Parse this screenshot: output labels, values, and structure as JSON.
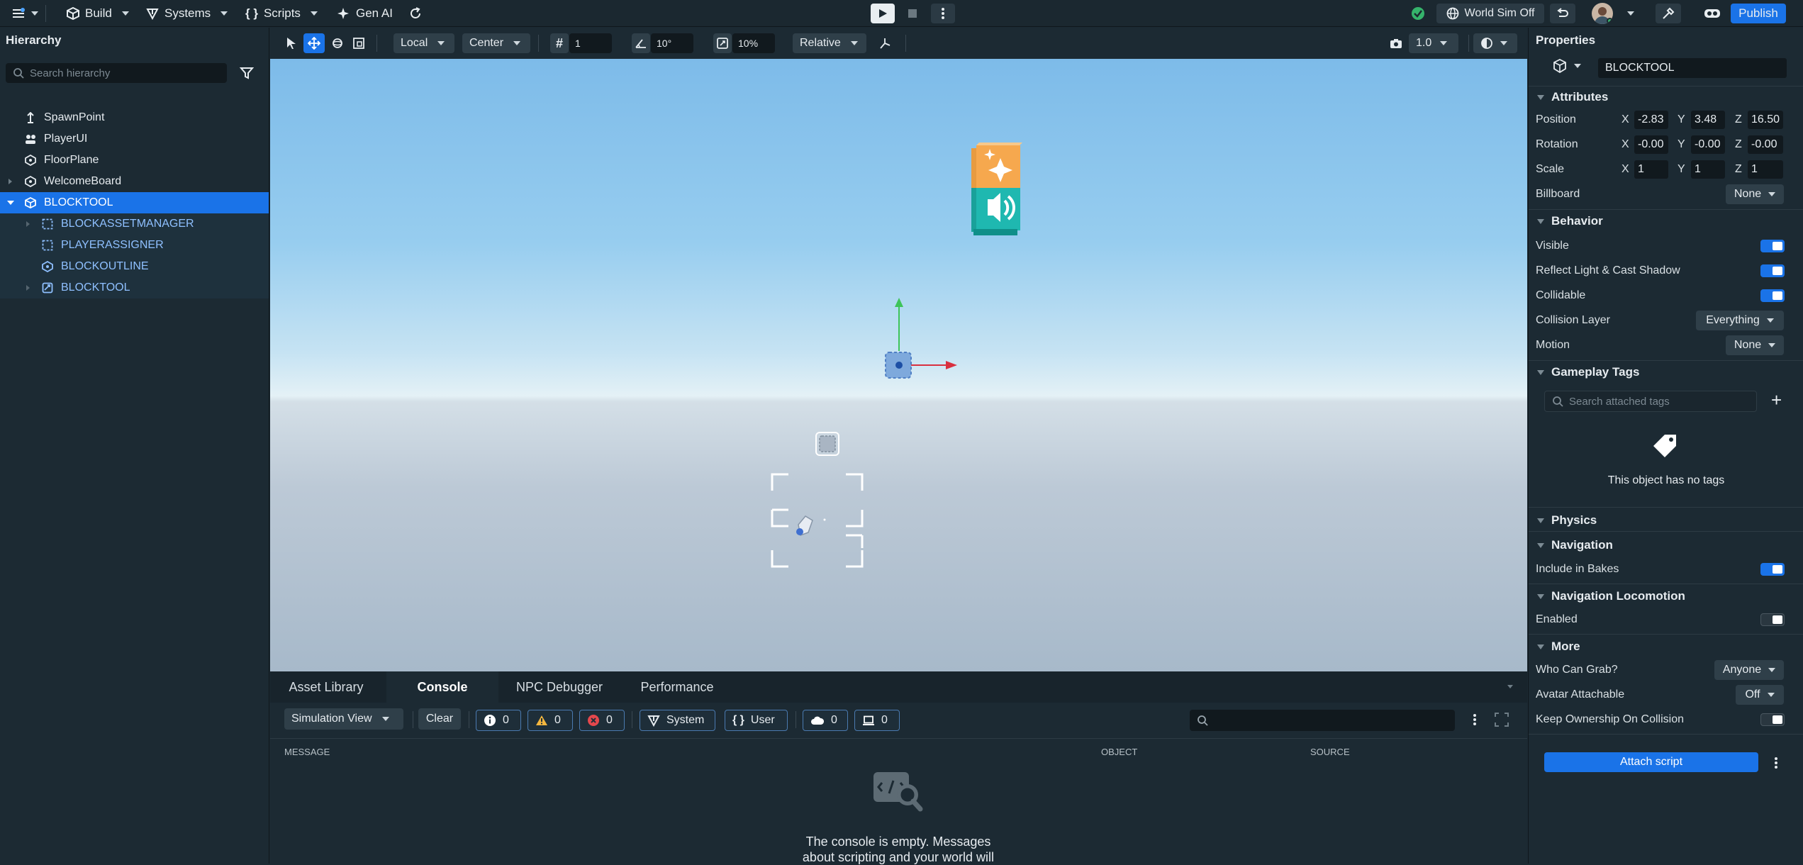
{
  "topbar": {
    "build_label": "Build",
    "systems_label": "Systems",
    "scripts_label": "Scripts",
    "genai_label": "Gen AI",
    "worldsim_label": "World Sim Off",
    "publish_label": "Publish"
  },
  "hierarchy": {
    "title": "Hierarchy",
    "search_placeholder": "Search hierarchy",
    "items": [
      {
        "label": "SpawnPoint",
        "icon": "spawn-icon"
      },
      {
        "label": "PlayerUI",
        "icon": "players-icon"
      },
      {
        "label": "FloorPlane",
        "icon": "mesh-icon"
      },
      {
        "label": "WelcomeBoard",
        "icon": "mesh-icon"
      },
      {
        "label": "BLOCKTOOL",
        "icon": "cube-icon",
        "selected": true
      },
      {
        "label": "BLOCKASSETMANAGER",
        "icon": "empty-object-icon"
      },
      {
        "label": "PLAYERASSIGNER",
        "icon": "empty-object-icon"
      },
      {
        "label": "BLOCKOUTLINE",
        "icon": "mesh-icon"
      },
      {
        "label": "BLOCKTOOL",
        "icon": "gizmo-icon"
      }
    ]
  },
  "viewport_toolbar": {
    "space": "Local",
    "pivot": "Center",
    "grid_snap": "1",
    "rotation_snap": "10°",
    "scale_snap": "10%",
    "mode": "Relative",
    "camera_speed": "1.0"
  },
  "bottom": {
    "tabs": [
      "Asset Library",
      "Console",
      "NPC Debugger",
      "Performance"
    ],
    "active_tab": "Console",
    "view_select": "Simulation View",
    "clear_label": "Clear",
    "info_count": "0",
    "warning_count": "0",
    "error_count": "0",
    "system_label": "System",
    "user_label": "User",
    "server_count": "0",
    "client_count": "0",
    "columns": [
      "MESSAGE",
      "OBJECT",
      "SOURCE"
    ],
    "empty_line1": "The console is empty. Messages",
    "empty_line2": "about scripting and your world will"
  },
  "properties": {
    "title": "Properties",
    "object_name": "BLOCKTOOL",
    "attributes_title": "Attributes",
    "position_label": "Position",
    "position": {
      "x": "-2.83",
      "y": "3.48",
      "z": "16.50"
    },
    "rotation_label": "Rotation",
    "rotation": {
      "x": "-0.00",
      "y": "-0.00",
      "z": "-0.00"
    },
    "scale_label": "Scale",
    "scale": {
      "x": "1",
      "y": "1",
      "z": "1"
    },
    "billboard_label": "Billboard",
    "billboard_value": "None",
    "behavior_title": "Behavior",
    "visible_label": "Visible",
    "reflect_label": "Reflect Light & Cast Shadow",
    "collidable_label": "Collidable",
    "collision_layer_label": "Collision Layer",
    "collision_layer_value": "Everything",
    "motion_label": "Motion",
    "motion_value": "None",
    "tags_title": "Gameplay Tags",
    "tags_search_placeholder": "Search attached tags",
    "no_tags_text": "This object has no tags",
    "physics_title": "Physics",
    "navigation_title": "Navigation",
    "include_bakes_label": "Include in Bakes",
    "nav_locomotion_title": "Navigation Locomotion",
    "enabled_label": "Enabled",
    "more_title": "More",
    "who_grab_label": "Who Can Grab?",
    "who_grab_value": "Anyone",
    "avatar_attach_label": "Avatar Attachable",
    "avatar_attach_value": "Off",
    "keep_ownership_label": "Keep Ownership On Collision",
    "attach_script_label": "Attach script",
    "axis_x": "X",
    "axis_y": "Y",
    "axis_z": "Z"
  },
  "colors": {
    "accent": "#1a73e8",
    "panel": "#1c2a33",
    "selected_row": "#1a73e8",
    "child_text": "#8fc0ff"
  }
}
